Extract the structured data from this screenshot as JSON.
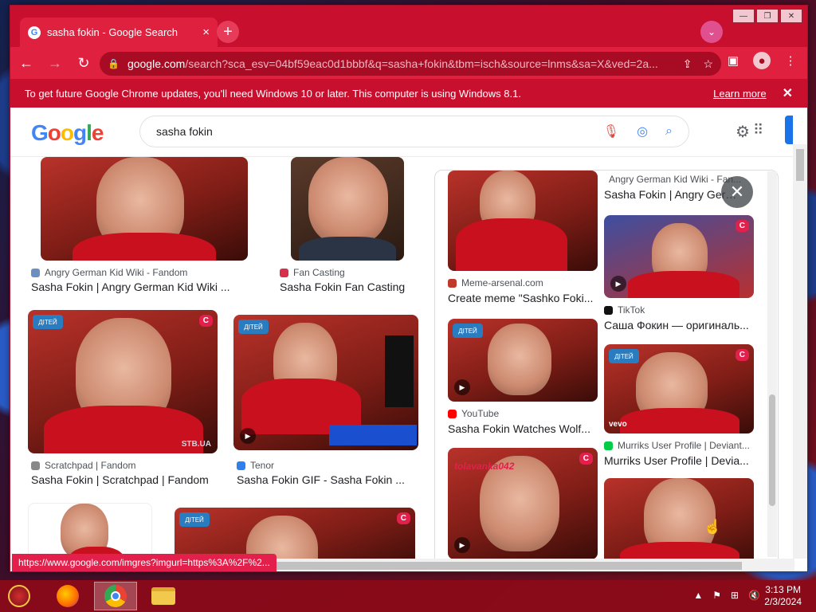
{
  "browser": {
    "tab_title": "sasha fokin - Google Search",
    "tab_close": "×",
    "new_tab": "+",
    "tab_search": "⌄",
    "url_domain": "google.com",
    "url_rest": "/search?sca_esv=04bf59eac0d1bbbf&q=sasha+fokin&tbm=isch&source=lnms&sa=X&ved=2a...",
    "window_controls": [
      "—",
      "❐",
      "✕"
    ],
    "infobar_message": "To get future Google Chrome updates, you'll need Windows 10 or later. This computer is using Windows 8.1.",
    "infobar_link": "Learn more",
    "status_url": "https://www.google.com/imgres?imgurl=https%3A%2F%2..."
  },
  "google": {
    "logo": [
      "G",
      "o",
      "o",
      "g",
      "l",
      "e"
    ],
    "search_value": "sasha fokin"
  },
  "results_left": [
    {
      "source": "Angry German Kid Wiki - Fandom",
      "title": "Sasha Fokin | Angry German Kid Wiki ...",
      "icon_color": "#6b8fbf"
    },
    {
      "source": "Fan Casting",
      "title": "Sasha Fokin Fan Casting",
      "icon_color": "#d6304b"
    },
    {
      "source": "Scratchpad | Fandom",
      "title": "Sasha Fokin | Scratchpad | Fandom",
      "icon_color": "#888888",
      "watermark": "STB.UA"
    },
    {
      "source": "Tenor",
      "title": "Sasha Fokin GIF - Sasha Fokin ...",
      "icon_color": "#2f80ed"
    }
  ],
  "results_panel": [
    {
      "source": "Angry German Kid Wiki - Fan...",
      "title": "Sasha Fokin | Angry Germa...",
      "icon_color": "#6b8fbf"
    },
    {
      "source": "Meme-arsenal.com",
      "title": "Create meme \"Sashko Foki...",
      "icon_color": "#c0392b"
    },
    {
      "source": "TikTok",
      "title": "Саша Фокин — оригиналь...",
      "icon_color": "#111111"
    },
    {
      "source": "YouTube",
      "title": "Sasha Fokin Watches Wolf...",
      "icon_color": "#ff0000"
    },
    {
      "source": "Murriks User Profile | Deviant...",
      "title": "Murriks User Profile | Devia...",
      "icon_color": "#05cc47"
    }
  ],
  "panel_overlay_text": "tolavanka042",
  "thumb_badges": {
    "c": "C",
    "channel": "ДІТЕЙ",
    "vevo": "vevo"
  },
  "taskbar": {
    "time": "3:13 PM",
    "date": "2/3/2024"
  }
}
